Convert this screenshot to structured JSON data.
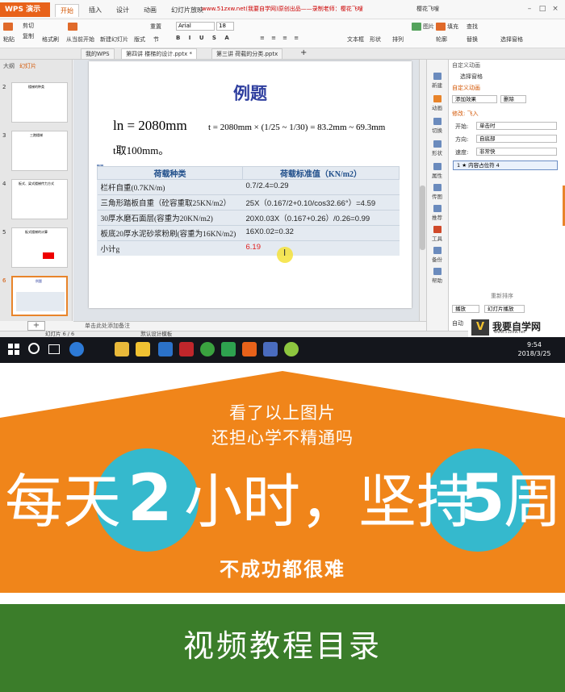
{
  "app": {
    "name": "WPS 演示",
    "ribbon_tabs": [
      "开始",
      "插入",
      "设计",
      "动画",
      "幻灯片放映"
    ],
    "active_tab": "开始",
    "promo_url": "www.51zxw.net(我要自学网)原创出品——录制老师：樱花飞嗖",
    "user": "樱花飞嗖",
    "ribbon": {
      "paste": "粘贴",
      "cut": "剪切",
      "copy": "复制",
      "format_painter": "格式刷",
      "from_current": "从当前开始",
      "new_slide": "新建幻灯片",
      "layout": "版式",
      "section": "节",
      "reset": "重置",
      "font": "Arial",
      "size": "18",
      "textbox": "文本框",
      "shape": "形状",
      "arrange": "排列",
      "picture": "图片",
      "fill": "填充",
      "outline": "轮廓",
      "find": "查找",
      "replace": "替换",
      "select_pane": "选择窗格"
    },
    "doc_tabs": [
      "我的WPS",
      "第四讲 楼梯的设计.pptx *",
      "第三讲 荷载的分类.pptx"
    ],
    "left_pane_tabs": [
      "大纲",
      "幻灯片"
    ],
    "thumbs": [
      {
        "num": "2",
        "label": "楼梯的种类"
      },
      {
        "num": "3",
        "label": "三跑楼梯"
      },
      {
        "num": "4",
        "label": "板式、梁式楼梯传力方式"
      },
      {
        "num": "5",
        "label": "板式楼梯的计算"
      },
      {
        "num": "6",
        "label": "例题"
      }
    ],
    "slide": {
      "title": "例题",
      "formula_main": "ln = 2080mm",
      "formula_eq": "t = 2080mm × (1/25 ~ 1/30) = 83.2mm ~ 69.3mm",
      "t_value": "t取100mm。",
      "table": {
        "headers": [
          "荷载种类",
          "荷载标准值（KN/m2）"
        ],
        "rows": [
          [
            "栏杆自重(0.7KN/m)",
            "0.7/2.4=0.29"
          ],
          [
            "三角形踏板自重（砼容重取25KN/m2）",
            "25X（0.167/2+0.10/cos32.66°）=4.59"
          ],
          [
            "30厚水磨石面层(容重为20KN/m2)",
            "20X0.03X（0.167+0.26）/0.26=0.99"
          ],
          [
            "板底20厚水泥砂浆粉刷(容重为16KN/m2)",
            "16X0.02=0.32"
          ],
          [
            "小计g",
            "6.19"
          ]
        ]
      }
    },
    "notes_placeholder": "单击此处添加备注",
    "status": {
      "slide_counter": "幻灯片 6 / 6",
      "template": "默认设计模板"
    },
    "side_tools": [
      "新建",
      "动画",
      "切换",
      "形状",
      "属性",
      "传图",
      "推荐",
      "工具",
      "备份",
      "帮助"
    ],
    "anim_pane": {
      "title": "自定义动画",
      "select_pane": "选择窗格",
      "custom_anim": "自定义动画",
      "add_effect": "添加效果",
      "delete": "删除",
      "modify": "修改: 飞入",
      "start_label": "开始:",
      "start_value": "单击时",
      "direction_label": "方向:",
      "direction_value": "自底部",
      "speed_label": "速度:",
      "speed_value": "非常快",
      "item": "1 ★ 内容占位符 4",
      "reorder": "重新排序",
      "play": "播放",
      "slideshow": "幻灯片播放",
      "auto_preview": "自动"
    },
    "logo": {
      "text": "我要自学网",
      "url": "www.51zxw.net"
    }
  },
  "taskbar": {
    "time": "9:54",
    "date": "2018/3/25"
  },
  "banner": {
    "line1": "看了以上图片",
    "line2": "还担心学不精通吗",
    "slogan_a": "每天",
    "num_a": "2",
    "slogan_b": "小时，坚持",
    "num_b": "5",
    "slogan_c": "周",
    "line3": "不成功都很难"
  },
  "footer": {
    "title": "视频教程目录"
  },
  "colors": {
    "orange": "#f0851a",
    "teal": "#35b9cd",
    "green": "#3b7d2a",
    "wps_orange": "#e8621a"
  }
}
